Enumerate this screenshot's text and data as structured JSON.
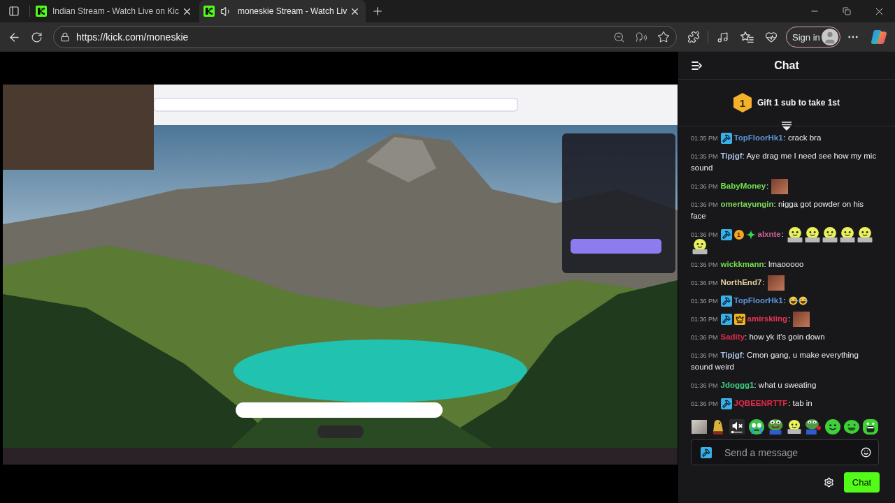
{
  "browser": {
    "tabs": [
      {
        "title": "Indian Stream - Watch Live on Kic",
        "selected": false,
        "playing_audio": false
      },
      {
        "title": "moneskie Stream - Watch Liv",
        "selected": true,
        "playing_audio": true
      }
    ],
    "address_bar": {
      "url": "https://kick.com/moneskie"
    },
    "sign_in": {
      "label": "Sign in"
    }
  },
  "chat": {
    "title": "Chat",
    "pinned": {
      "rank": "1",
      "text": "Gift 1 sub to take 1st"
    },
    "messages": [
      {
        "time": "01:35 PM",
        "badges": [
          {
            "kind": "moderator"
          }
        ],
        "user": "TopFloorHk1",
        "color": "#5b96d8",
        "text": ": crack bra"
      },
      {
        "time": "01:35 PM",
        "user": "Tipjgf",
        "color": "#a9bfe3",
        "text": ": Aye drag me I need see how my mic sound"
      },
      {
        "time": "01:36 PM",
        "user": "BabyMoney",
        "color": "#72e04c",
        "text": ":",
        "emotes": [
          {
            "kind": "photo"
          }
        ]
      },
      {
        "time": "01:36 PM",
        "user": "omertayungin",
        "color": "#7fd85a",
        "text": ": nigga got powder on his face"
      },
      {
        "time": "01:36 PM",
        "badges": [
          {
            "kind": "moderator"
          },
          {
            "kind": "gifter",
            "text": "1"
          },
          {
            "kind": "sparkle"
          }
        ],
        "user": "alxnte",
        "color": "#d0629c",
        "text": ":",
        "emotes": [
          {
            "kind": "laptop_blob"
          },
          {
            "kind": "laptop_blob"
          },
          {
            "kind": "laptop_blob"
          },
          {
            "kind": "laptop_blob"
          },
          {
            "kind": "laptop_blob"
          },
          {
            "kind": "laptop_blob"
          }
        ]
      },
      {
        "time": "01:36 PM",
        "user": "wickkmann",
        "color": "#74dc4e",
        "text": ": lmaooooo"
      },
      {
        "time": "01:36 PM",
        "user": "NorthEnd7",
        "color": "#e4cf9c",
        "text": ":",
        "emotes": [
          {
            "kind": "photo"
          }
        ]
      },
      {
        "time": "01:36 PM",
        "badges": [
          {
            "kind": "moderator"
          }
        ],
        "user": "TopFloorHk1",
        "color": "#5b96d8",
        "text": ":",
        "emotes": [
          {
            "kind": "laugh"
          },
          {
            "kind": "laugh"
          }
        ]
      },
      {
        "time": "01:36 PM",
        "badges": [
          {
            "kind": "moderator"
          },
          {
            "kind": "crown"
          }
        ],
        "user": "amirskiing",
        "color": "#e8344e",
        "text": ":",
        "emotes": [
          {
            "kind": "photo"
          }
        ]
      },
      {
        "time": "01:36 PM",
        "user": "Sadity",
        "color": "#e02a4c",
        "text": ": how yk it's goin down"
      },
      {
        "time": "01:36 PM",
        "user": "Tipjgf",
        "color": "#a9bfe3",
        "text": ": Cmon gang, u make everything sound weird"
      },
      {
        "time": "01:36 PM",
        "user": "Jdoggg1",
        "color": "#3fcf80",
        "text": ": what u sweating"
      },
      {
        "time": "01:36 PM",
        "badges": [
          {
            "kind": "moderator"
          }
        ],
        "user": "JQBEENRTTF",
        "color": "#e62a48",
        "text": ": tab in"
      }
    ],
    "quick_emotes": [
      {
        "kind": "photo"
      },
      {
        "kind": "figure"
      },
      {
        "kind": "mute"
      },
      {
        "kind": "crying"
      },
      {
        "kind": "frog"
      },
      {
        "kind": "laptop_blob"
      },
      {
        "kind": "frog_rose"
      },
      {
        "kind": "smile"
      },
      {
        "kind": "grin"
      },
      {
        "kind": "scream"
      }
    ],
    "input": {
      "placeholder": "Send a message"
    },
    "send_button": {
      "label": "Chat"
    }
  }
}
